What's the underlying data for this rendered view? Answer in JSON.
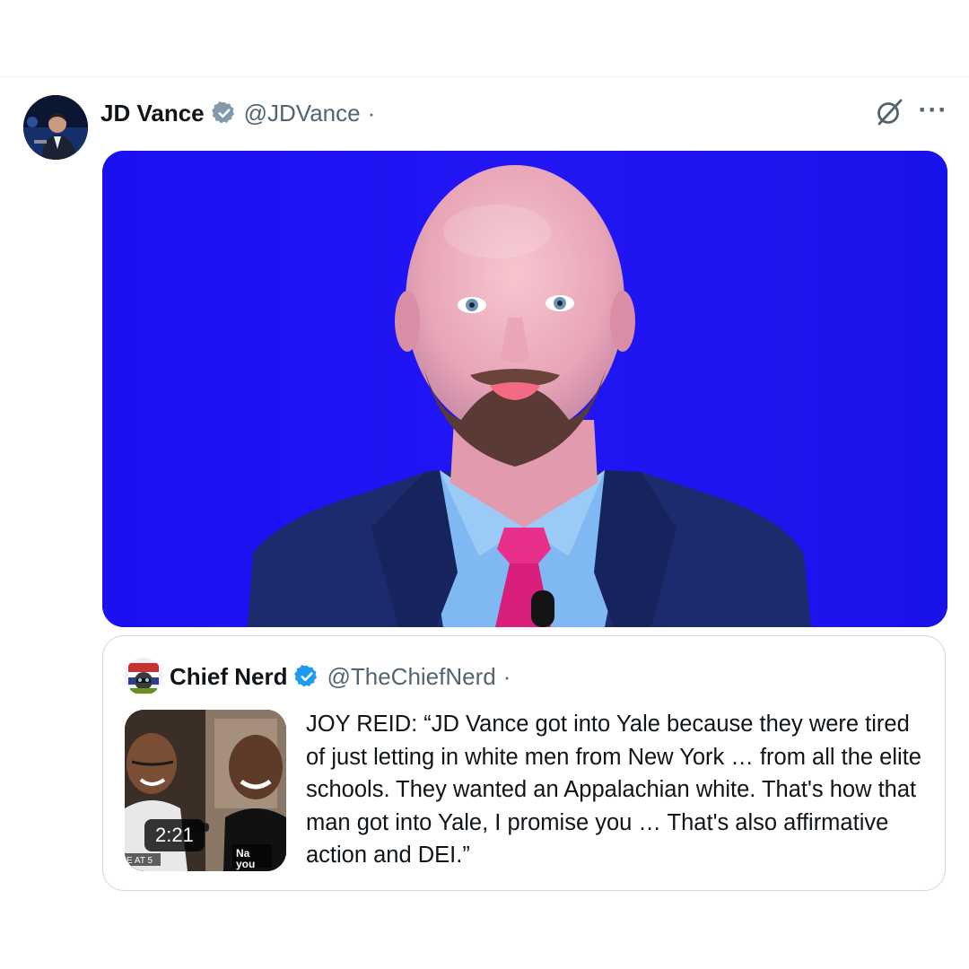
{
  "post": {
    "author_name": "JD Vance",
    "author_handle": "@JDVance",
    "separator": "·",
    "avatar_icon": "profile-photo",
    "verified_icon": "verified-badge-icon",
    "verified_color": "#829aab",
    "grok_icon": "grok-icon",
    "more_label": "···",
    "media_background": "#1a12f2"
  },
  "quote": {
    "author_name": "Chief Nerd",
    "author_handle": "@TheChiefNerd",
    "separator": "·",
    "verified_color": "#1d9bf0",
    "video_duration": "2:21",
    "text": "JOY REID: “JD Vance got into Yale because they were tired of just letting in white men from New York … from all the elite schools. They wanted an Appalachian white. That's how that man got into Yale, I promise you … That's also affirmative action and DEI.”"
  },
  "colors": {
    "text_primary": "#0f1419",
    "text_secondary": "#536471",
    "border": "#cfd9de"
  }
}
